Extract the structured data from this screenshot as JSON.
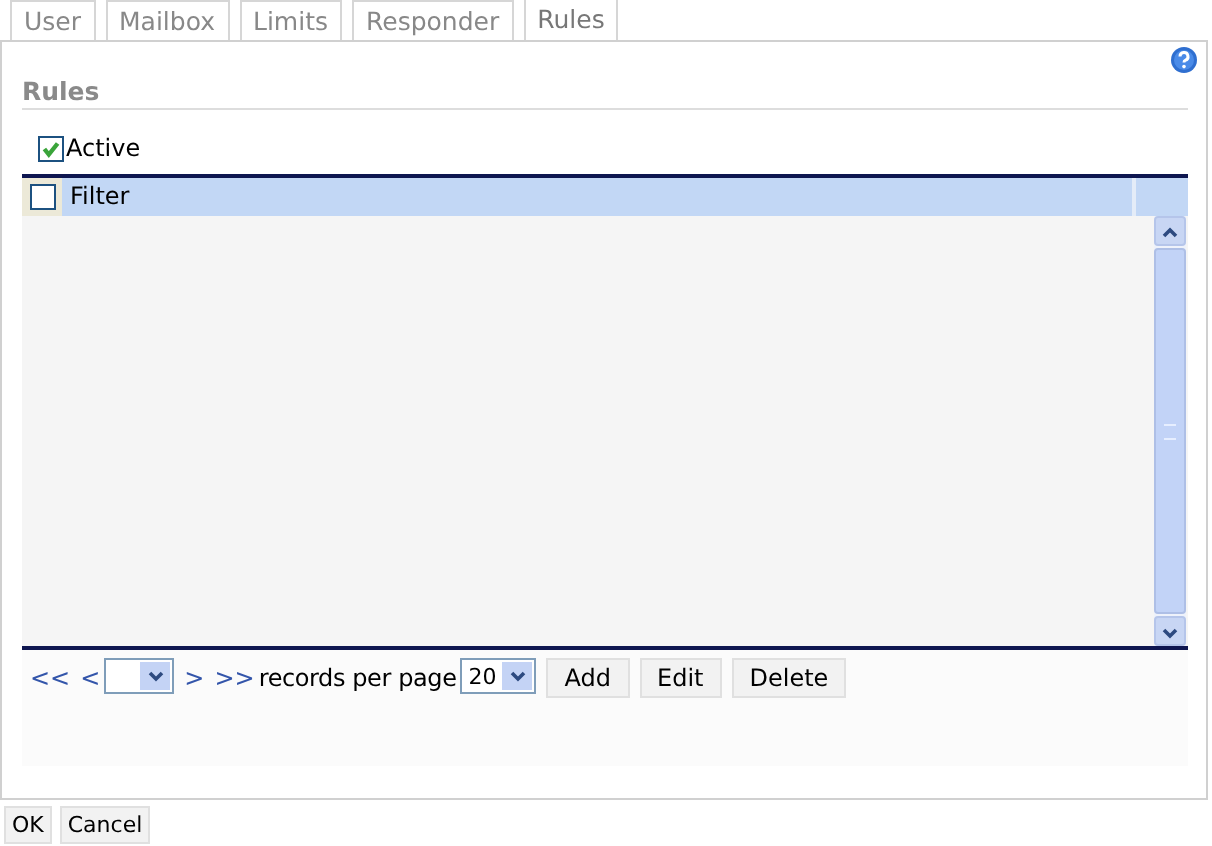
{
  "tabs": [
    {
      "label": "User",
      "selected": false
    },
    {
      "label": "Mailbox",
      "selected": false
    },
    {
      "label": "Limits",
      "selected": false
    },
    {
      "label": "Responder",
      "selected": false
    },
    {
      "label": "Rules",
      "selected": true
    }
  ],
  "section": {
    "title": "Rules"
  },
  "active": {
    "label": "Active",
    "checked": true
  },
  "grid": {
    "header_checkbox": {
      "checked": false
    },
    "columns": [
      "Filter"
    ]
  },
  "pager": {
    "first": "<<",
    "prev": "<",
    "next": ">",
    "last": ">>",
    "label": "records per page",
    "per_page": "20"
  },
  "grid_buttons": [
    "Add",
    "Edit",
    "Delete"
  ],
  "footer_buttons": [
    "OK",
    "Cancel"
  ]
}
